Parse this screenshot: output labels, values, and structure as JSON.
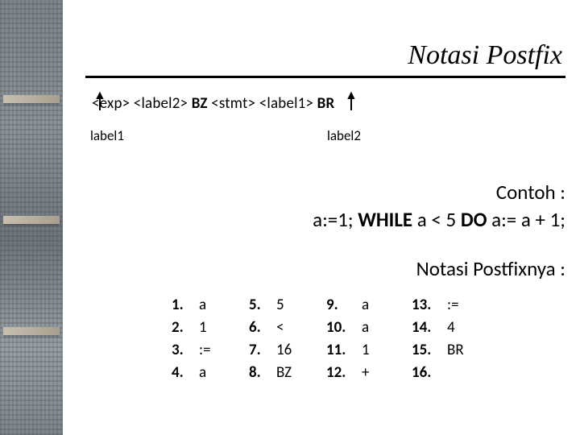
{
  "title": "Notasi Postfix",
  "expression": {
    "parts": {
      "p1": "<exp> <label2> ",
      "p2": "BZ",
      "p3": " <stmt> <label1> ",
      "p4": "BR"
    },
    "label_left": "label1",
    "label_right": "label2"
  },
  "contoh": {
    "heading": "Contoh :",
    "line_prefix": "a:=1; ",
    "while": "WHILE",
    "mid": " a < 5 ",
    "do": "DO",
    "suffix": " a:= a + 1;"
  },
  "nplabel": "Notasi Postfixnya :",
  "list": [
    {
      "n": "1.",
      "v": "a"
    },
    {
      "n": "2.",
      "v": "1"
    },
    {
      "n": "3.",
      "v": ":="
    },
    {
      "n": "4.",
      "v": "a"
    },
    {
      "n": "5.",
      "v": "5"
    },
    {
      "n": "6.",
      "v": "<"
    },
    {
      "n": "7.",
      "v": "16"
    },
    {
      "n": "8.",
      "v": "BZ"
    },
    {
      "n": "9.",
      "v": "a"
    },
    {
      "n": "10.",
      "v": "a"
    },
    {
      "n": "11.",
      "v": "1"
    },
    {
      "n": "12.",
      "v": "+"
    },
    {
      "n": "13.",
      "v": ":="
    },
    {
      "n": "14.",
      "v": "4"
    },
    {
      "n": "15.",
      "v": "BR"
    },
    {
      "n": "16.",
      "v": ""
    }
  ]
}
